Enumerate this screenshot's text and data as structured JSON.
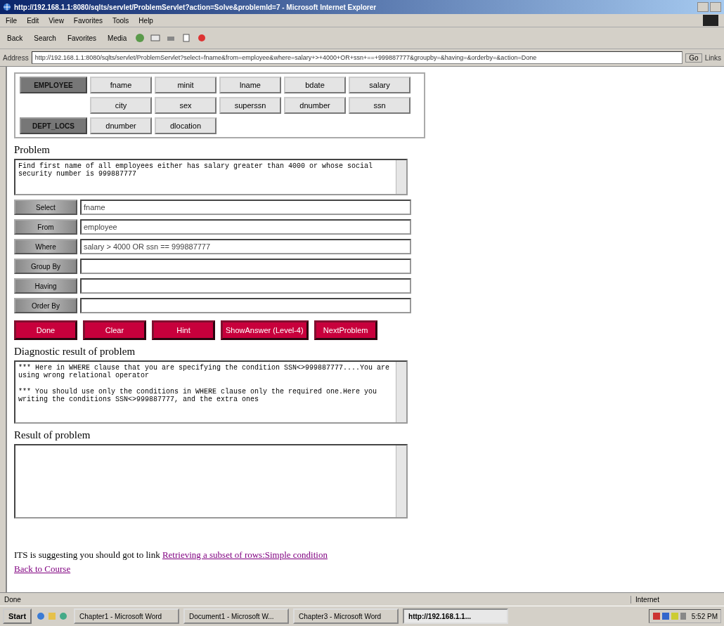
{
  "window": {
    "title": "http://192.168.1.1:8080/sqlts/servlet/ProblemServlet?action=Solve&problemId=7 - Microsoft Internet Explorer"
  },
  "menu": [
    "File",
    "Edit",
    "View",
    "Favorites",
    "Tools",
    "Help"
  ],
  "toolbar": [
    "Back",
    "Search",
    "Favorites",
    "Media"
  ],
  "address": {
    "label": "Address",
    "url": "http://192.168.1.1:8080/sqlts/servlet/ProblemServlet?select=fname&from=employee&where=salary+>+4000+OR+ssn+==+999887777&groupby=&having=&orderby=&action=Done",
    "go": "Go",
    "links": "Links"
  },
  "schema": [
    {
      "table": "EMPLOYEE",
      "columns": [
        "fname",
        "minit",
        "lname",
        "bdate",
        "salary"
      ]
    },
    {
      "columns": [
        "city",
        "sex",
        "superssn",
        "dnumber",
        "ssn"
      ]
    },
    {
      "table": "DEPT_LOCS",
      "columns": [
        "dnumber",
        "dlocation"
      ]
    }
  ],
  "problem": {
    "label": "Problem",
    "text": "Find first name of all employees either has salary greater than 4000 or whose social security number is 999887777"
  },
  "clauses": [
    {
      "label": "Select",
      "value": "fname"
    },
    {
      "label": "From",
      "value": "employee"
    },
    {
      "label": "Where",
      "value": "salary > 4000 OR ssn == 999887777"
    },
    {
      "label": "Group By"
    },
    {
      "label": "Having"
    },
    {
      "label": "Order By"
    }
  ],
  "actions": [
    "Done",
    "Clear",
    "Hint",
    "ShowAnswer (Level-4)",
    "NextProblem"
  ],
  "diagnostic": {
    "label": "Diagnostic result of problem",
    "messages": [
      "*** Here in WHERE clause that you are specifying the condition SSN<>999887777....You are using wrong relational operator",
      "*** You should use only the conditions in WHERE clause only the required one.Here you writing the conditions SSN<>999887777, and the extra ones"
    ]
  },
  "result": {
    "label": "Result of problem"
  },
  "suggestion": {
    "text": "ITS is suggesting you should got to link",
    "link": "Retrieving a subset of rows:Simple condition"
  },
  "back_link": "Back to Course",
  "status_bar": {
    "text": "Done",
    "zone": "Internet"
  },
  "taskbar": {
    "start": "Start",
    "items": [
      {
        "label": "Chapter1 - Microsoft Word",
        "selected": false
      },
      {
        "label": "Document1 - Microsoft W...",
        "selected": false
      },
      {
        "label": "Chapter3 - Microsoft Word",
        "selected": false
      },
      {
        "label": "http://192.168.1.1...",
        "selected": true
      }
    ],
    "clock": "5:52 PM"
  }
}
